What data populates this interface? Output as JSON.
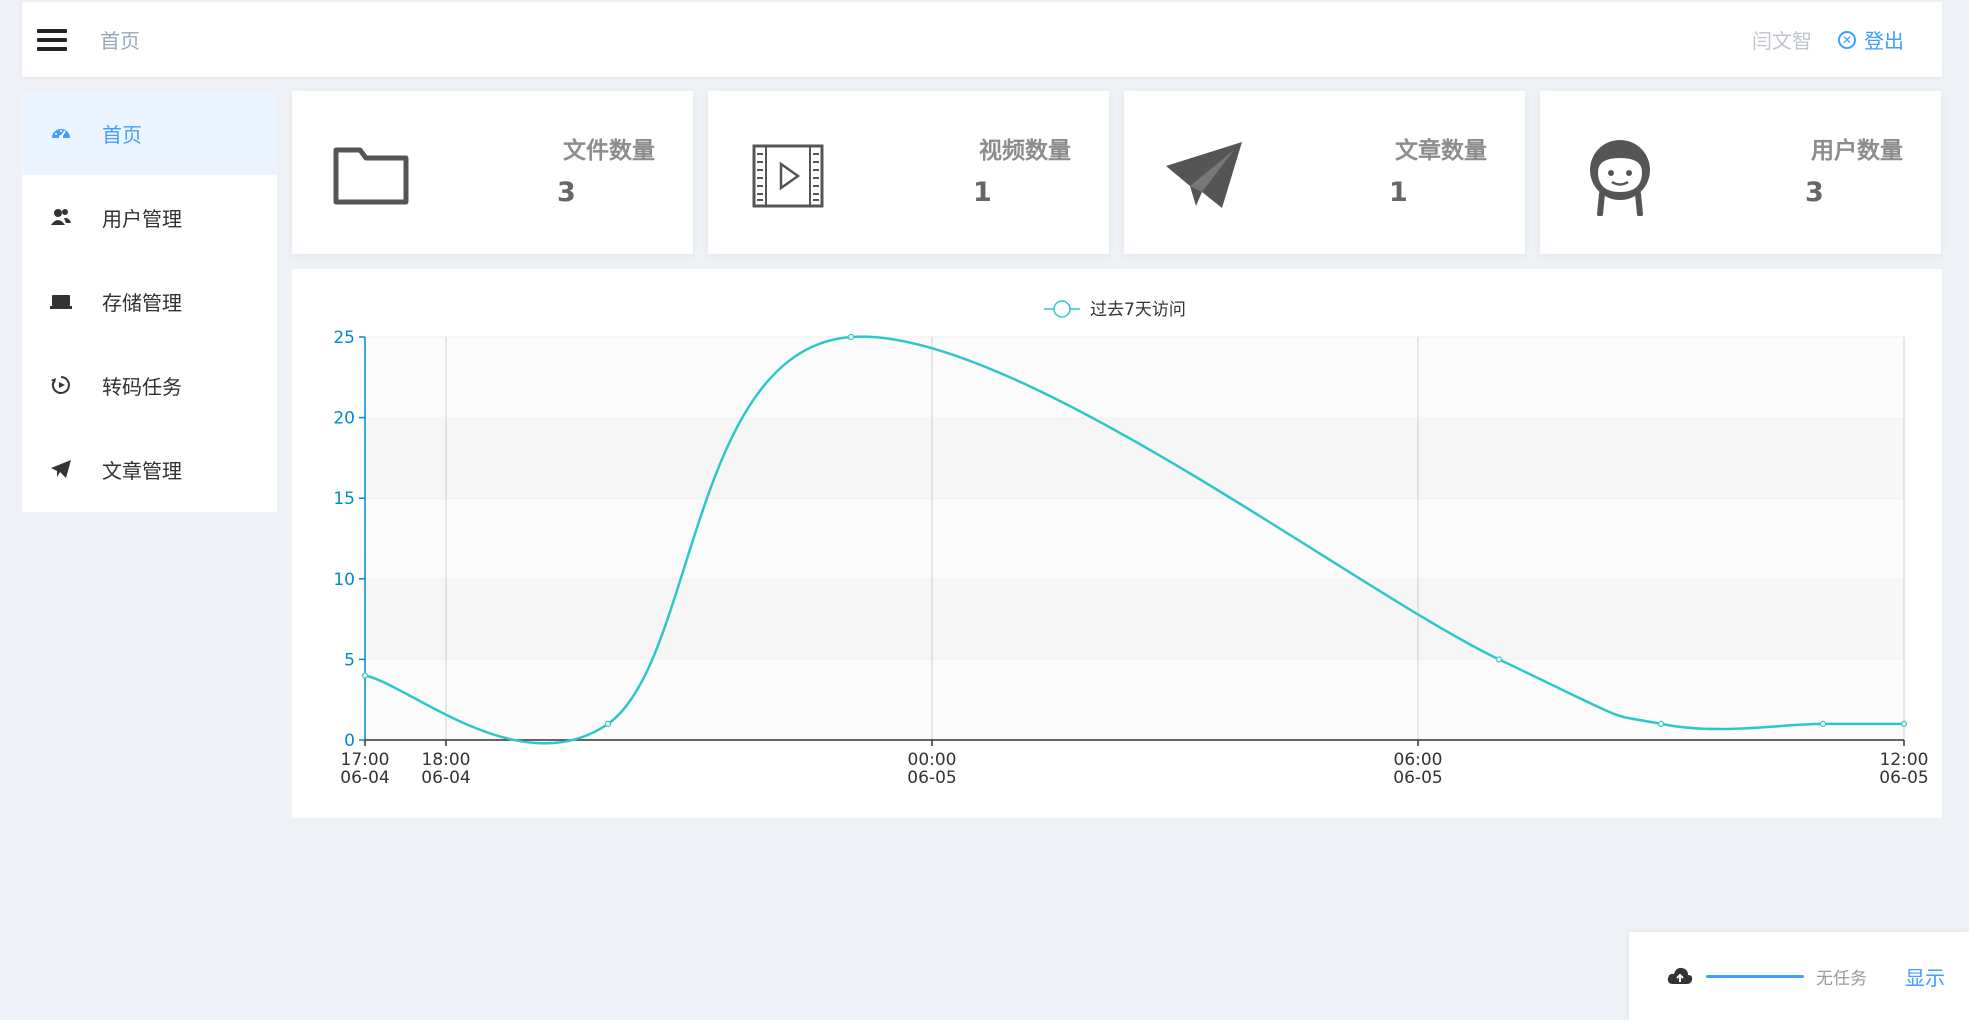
{
  "header": {
    "breadcrumb": "首页",
    "username": "闫文智",
    "logout_label": "登出"
  },
  "sidebar": {
    "items": [
      {
        "label": "首页",
        "icon": "dashboard-icon",
        "active": true
      },
      {
        "label": "用户管理",
        "icon": "users-icon",
        "active": false
      },
      {
        "label": "存储管理",
        "icon": "storage-icon",
        "active": false
      },
      {
        "label": "转码任务",
        "icon": "transcode-icon",
        "active": false
      },
      {
        "label": "文章管理",
        "icon": "paper-plane-icon",
        "active": false
      }
    ]
  },
  "stats": [
    {
      "title": "文件数量",
      "value": "3",
      "icon": "folder-icon"
    },
    {
      "title": "视频数量",
      "value": "1",
      "icon": "video-icon"
    },
    {
      "title": "文章数量",
      "value": "1",
      "icon": "paper-plane-icon"
    },
    {
      "title": "用户数量",
      "value": "3",
      "icon": "user-face-icon"
    }
  ],
  "chart_data": {
    "type": "line",
    "series": [
      {
        "name": "过去7天访问",
        "color": "#2ec7c9",
        "points": [
          {
            "x": "06-04 17:00",
            "y": 4
          },
          {
            "x": "06-04 20:00",
            "y": 1
          },
          {
            "x": "06-04 23:00",
            "y": 25
          },
          {
            "x": "06-05 07:00",
            "y": 5
          },
          {
            "x": "06-05 09:00",
            "y": 1
          },
          {
            "x": "06-05 11:00",
            "y": 1
          },
          {
            "x": "06-05 12:00",
            "y": 1
          }
        ]
      }
    ],
    "x_ticks": [
      {
        "time": "17:00",
        "date": "06-04"
      },
      {
        "time": "18:00",
        "date": "06-04"
      },
      {
        "time": "00:00",
        "date": "06-05"
      },
      {
        "time": "06:00",
        "date": "06-05"
      },
      {
        "time": "12:00",
        "date": "06-05"
      }
    ],
    "y_ticks": [
      "0",
      "5",
      "10",
      "15",
      "20",
      "25"
    ],
    "ylim": [
      0,
      25
    ],
    "legend_position": "top-center",
    "grid": true,
    "axis_color": "#008acd"
  },
  "task_bar": {
    "status": "无任务",
    "show_label": "显示",
    "progress": 1
  }
}
